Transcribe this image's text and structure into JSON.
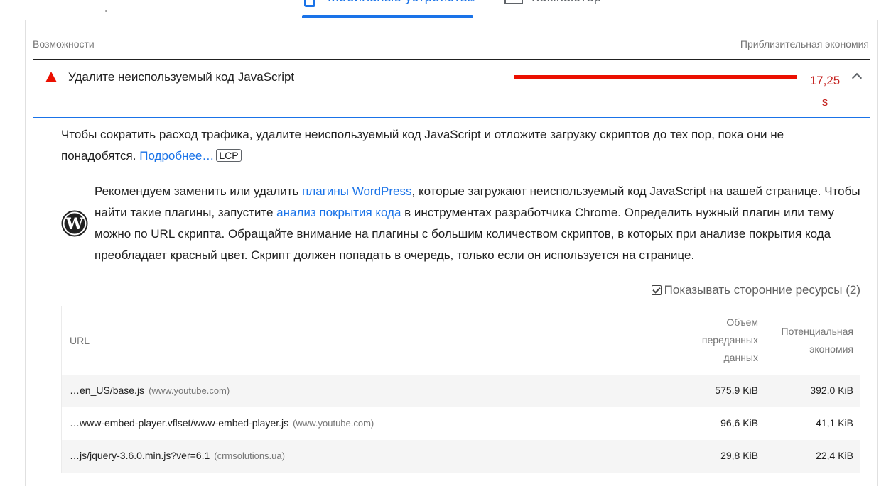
{
  "tabs": {
    "mobile_label": "Мобильные устройства",
    "desktop_label": "Компьютер",
    "active": "mobile"
  },
  "opportunities": {
    "column_left": "Возможности",
    "column_right": "Приблизительная экономия"
  },
  "audit": {
    "icon": "warning-triangle-icon",
    "title": "Удалите неиспользуемый код JavaScript",
    "savings_value": "17,25",
    "savings_unit": "s",
    "status_color": "#eb0f00",
    "expanded": true
  },
  "description": {
    "text": "Чтобы сократить расход трафика, удалите неиспользуемый код JavaScript и отложите загрузку скриптов до тех пор, пока они не понадобятся.",
    "link": "Подробнее…",
    "badge": "LCP"
  },
  "wordpress_note": {
    "icon": "wordpress-icon",
    "text_1": "Рекомендуем заменить или удалить ",
    "link_1": "плагины WordPress",
    "text_2": ", которые загружают неиспользуемый код JavaScript на вашей странице. Чтобы найти такие плагины, запустите ",
    "link_2": "анализ покрытия кода",
    "text_3": " в инструментах разработчика Chrome. Определить нужный плагин или тему можно по URL скрипта. Обращайте внимание на плагины с большим количеством скриптов, в которых при анализе покрытия кода преобладает красный цвет. Скрипт должен попадать в очередь, только если он используется на странице."
  },
  "third_party": {
    "label": "Показывать сторонние ресурсы (2)",
    "checked": true
  },
  "table": {
    "headers": {
      "url": "URL",
      "size_line1": "Объем",
      "size_line2": "переданных",
      "size_line3": "данных",
      "savings_line1": "Потенциальная",
      "savings_line2": "экономия"
    },
    "rows": [
      {
        "url": "…en_US/base.js",
        "origin": "(www.youtube.com)",
        "size": "575,9 KiB",
        "savings": "392,0 KiB"
      },
      {
        "url": "…www-embed-player.vflset/www-embed-player.js",
        "origin": "(www.youtube.com)",
        "size": "96,6 KiB",
        "savings": "41,1 KiB"
      },
      {
        "url": "…js/jquery-3.6.0.min.js?ver=6.1",
        "origin": "(crmsolutions.ua)",
        "size": "29,8 KiB",
        "savings": "22,4 KiB"
      }
    ]
  }
}
